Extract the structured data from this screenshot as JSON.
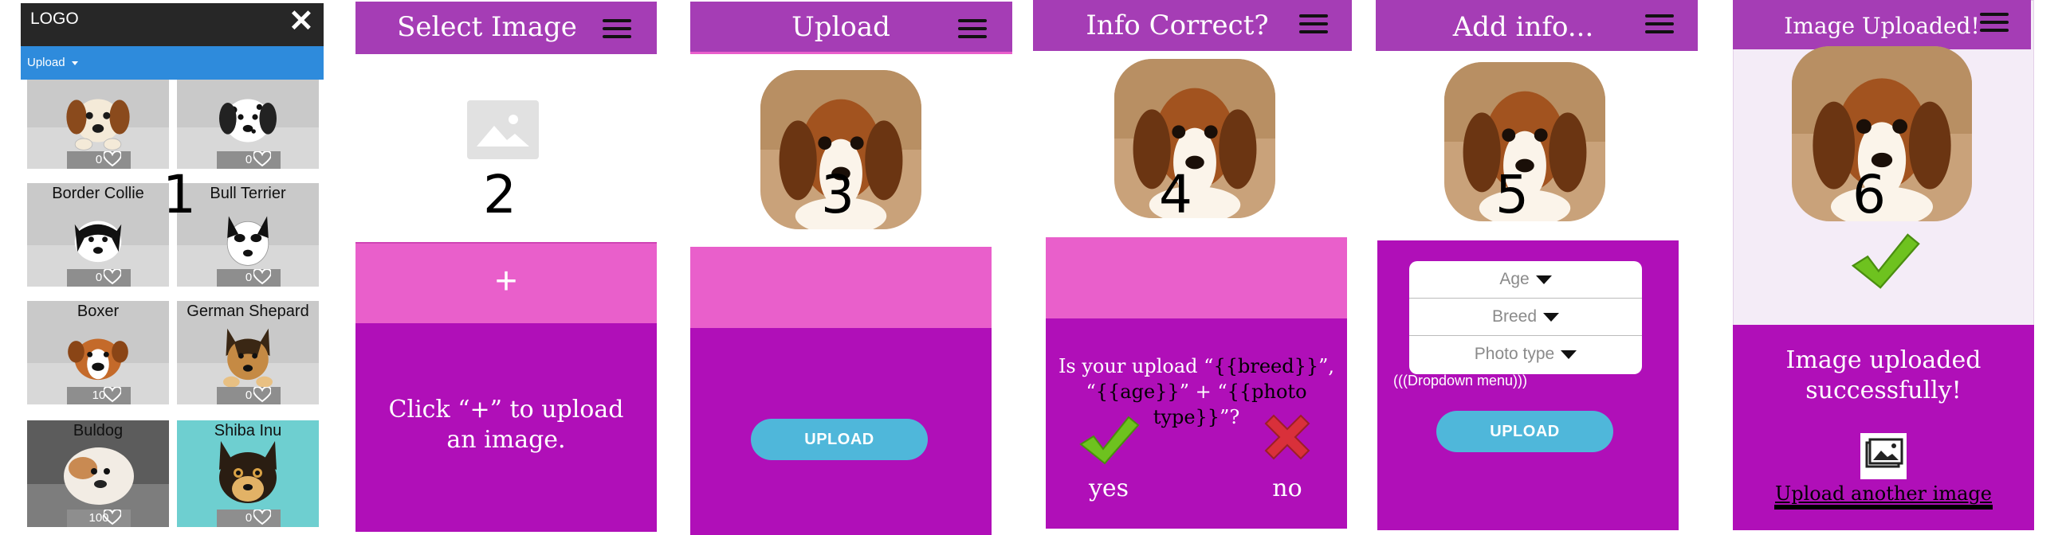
{
  "panel1": {
    "logo": "LOGO",
    "close_glyph": "✕",
    "nav_label": "Upload",
    "step": "1",
    "dogs": [
      {
        "name": "",
        "count": "0"
      },
      {
        "name": "",
        "count": "0"
      },
      {
        "name": "Border Collie",
        "count": "0"
      },
      {
        "name": "Bull Terrier",
        "count": "0"
      },
      {
        "name": "Boxer",
        "count": "10"
      },
      {
        "name": "German Shepard",
        "count": "0"
      },
      {
        "name": "Buldog",
        "count": "100"
      },
      {
        "name": "Shiba Inu",
        "count": "0"
      }
    ]
  },
  "panel2": {
    "title": "Select Image",
    "step": "2",
    "plus": "+",
    "message": "Click “+” to upload an image."
  },
  "panel3": {
    "title": "Upload",
    "step": "3",
    "button": "UPLOAD"
  },
  "panel4": {
    "title": "Info Correct?",
    "step": "4",
    "question_1": "Is your upload “",
    "breed_token": "{{breed}}",
    "question_2": "”,",
    "question_3": "“",
    "age_token": "{{age}}",
    "question_4": "” + “",
    "phototype_token": "{{photo type}}",
    "question_5": "”?",
    "yes": "yes",
    "no": "no"
  },
  "panel5": {
    "title": "Add info...",
    "step": "5",
    "options": [
      "Age",
      "Breed",
      "Photo type"
    ],
    "dropdown_note": "(((Dropdown menu)))",
    "button": "UPLOAD"
  },
  "panel6": {
    "title": "Image Uploaded!",
    "step": "6",
    "message": "Image uploaded successfully!",
    "link": "Upload another image"
  },
  "colors": {
    "magenta": "#b00fb8",
    "pink": "#e95fcb",
    "header": "#a53db5",
    "button": "#4fb7da",
    "nav_blue": "#2e8bdc"
  }
}
